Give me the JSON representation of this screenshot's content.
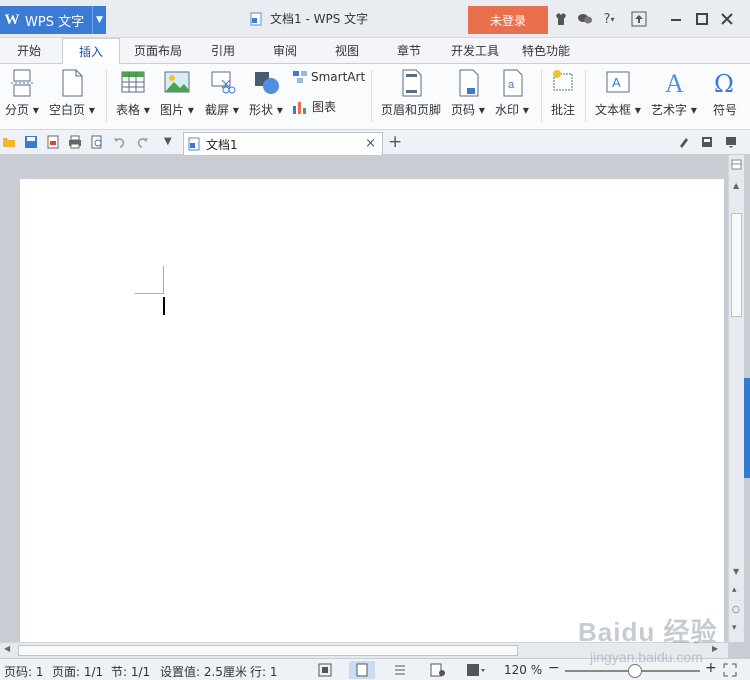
{
  "app": {
    "name": "WPS 文字",
    "window_title": "文档1 - WPS 文字",
    "login_label": "未登录"
  },
  "menu": {
    "tabs": [
      "开始",
      "插入",
      "页面布局",
      "引用",
      "审阅",
      "视图",
      "章节",
      "开发工具",
      "特色功能"
    ],
    "active_tab": "插入"
  },
  "ribbon": {
    "page_break": "分页",
    "blank_page": "空白页",
    "table": "表格",
    "picture": "图片",
    "screenshot": "截屏",
    "shape": "形状",
    "smartart": "SmartArt",
    "chart": "图表",
    "header_footer": "页眉和页脚",
    "page_number": "页码",
    "watermark": "水印",
    "comment": "批注",
    "textbox": "文本框",
    "wordart": "艺术字",
    "symbol": "符号"
  },
  "doc_tab": {
    "title": "文档1"
  },
  "status": {
    "page_num": "页码: 1",
    "pages": "页面: 1/1",
    "section": "节: 1/1",
    "setting": "设置值: 2.5厘米",
    "line": "行: 1",
    "zoom": "120 %",
    "zoom_fraction": 0.52
  },
  "watermark": {
    "text": "Baidu 经验",
    "url": "jingyan.baidu.com"
  },
  "colors": {
    "accent": "#3a7bd5",
    "login": "#e8704f"
  }
}
